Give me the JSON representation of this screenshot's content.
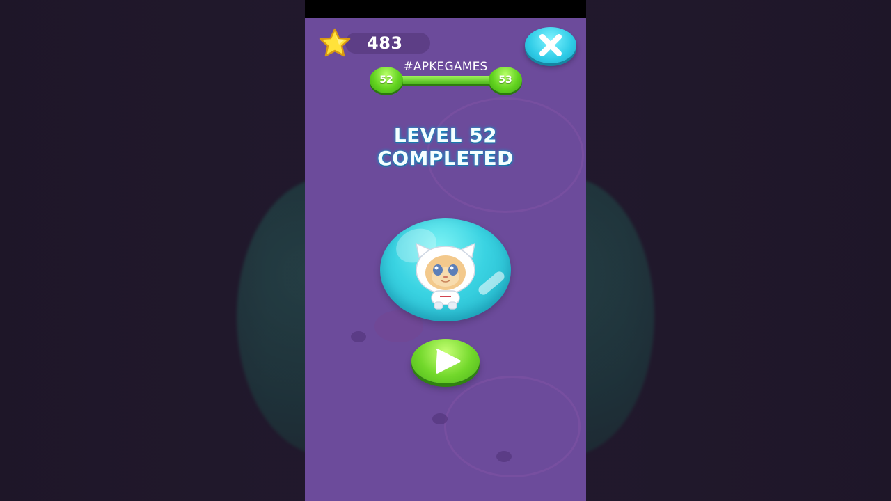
{
  "hud": {
    "score": "483",
    "close_icon": "close-icon",
    "star_icon": "star-icon"
  },
  "progress": {
    "watermark": "#APKEGAMES",
    "current_level": "52",
    "next_level": "53",
    "fill_fraction": 1.0
  },
  "result": {
    "title_line1": "LEVEL 52",
    "title_line2": "COMPLETED"
  },
  "actions": {
    "play_icon": "play-icon"
  },
  "colors": {
    "background": "#6c4b9b",
    "close_button": "#2ecbe6",
    "play_button": "#72d82b",
    "progress": "#62d31f",
    "title_glow": "#1e8fc4"
  }
}
